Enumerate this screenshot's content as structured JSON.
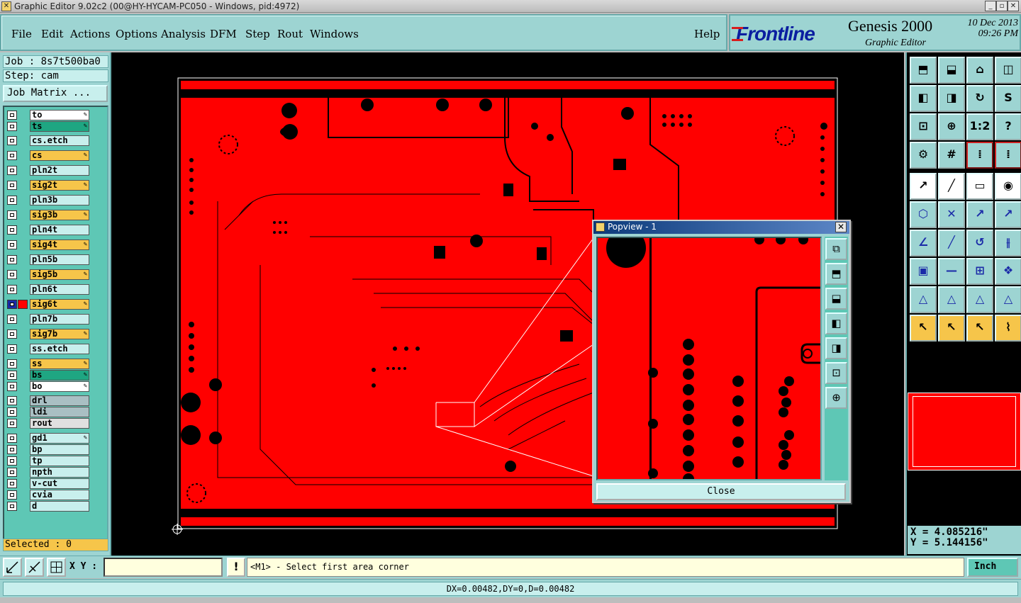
{
  "window": {
    "title": "Graphic Editor 9.02c2 (00@HY-HYCAM-PC050 - Windows, pid:4972)"
  },
  "menu": [
    "File",
    "Edit",
    "Actions",
    "Options",
    "Analysis",
    "DFM",
    "Step",
    "Rout",
    "Windows"
  ],
  "help": "Help",
  "brand": {
    "logo": "Frontline",
    "product": "Genesis 2000",
    "subtitle": "Graphic Editor",
    "date": "10 Dec 2013",
    "time": "09:26 PM"
  },
  "job": {
    "job_line": "Job : 8s7t500ba0",
    "step_line": "Step: cam",
    "matrix_button": "Job Matrix ..."
  },
  "layers": [
    {
      "name": "to",
      "color": "#ffffff",
      "pen": true
    },
    {
      "name": "ts",
      "color": "#1fa682",
      "pen": true
    },
    {
      "name": "cs.etch",
      "color": "#c8efed",
      "pen": false
    },
    {
      "name": "cs",
      "color": "#f6c54a",
      "pen": true
    },
    {
      "name": "pln2t",
      "color": "#c8efed",
      "pen": false
    },
    {
      "name": "sig2t",
      "color": "#f6c54a",
      "pen": true
    },
    {
      "name": "pln3b",
      "color": "#c8efed",
      "pen": false
    },
    {
      "name": "sig3b",
      "color": "#f6c54a",
      "pen": true
    },
    {
      "name": "pln4t",
      "color": "#c8efed",
      "pen": false
    },
    {
      "name": "sig4t",
      "color": "#f6c54a",
      "pen": true
    },
    {
      "name": "pln5b",
      "color": "#c8efed",
      "pen": false
    },
    {
      "name": "sig5b",
      "color": "#f6c54a",
      "pen": true
    },
    {
      "name": "pln6t",
      "color": "#c8efed",
      "pen": false
    },
    {
      "name": "sig6t",
      "color": "#f6c54a",
      "pen": true,
      "active": true
    },
    {
      "name": "pln7b",
      "color": "#c8efed",
      "pen": false
    },
    {
      "name": "sig7b",
      "color": "#f6c54a",
      "pen": true
    },
    {
      "name": "ss.etch",
      "color": "#c8efed",
      "pen": false
    },
    {
      "name": "ss",
      "color": "#f6c54a",
      "pen": true
    },
    {
      "name": "bs",
      "color": "#1fa682",
      "pen": true
    },
    {
      "name": "bo",
      "color": "#ffffff",
      "pen": true
    },
    {
      "name": "drl",
      "color": "#a9bfc3",
      "pen": false
    },
    {
      "name": "ldi",
      "color": "#a9bfc3",
      "pen": false
    },
    {
      "name": "rout",
      "color": "#e0e0e0",
      "pen": false
    },
    {
      "name": "gd1",
      "color": "#c8efed",
      "pen": true
    },
    {
      "name": "bp",
      "color": "#c8efed",
      "pen": false
    },
    {
      "name": "tp",
      "color": "#c8efed",
      "pen": false
    },
    {
      "name": "npth",
      "color": "#c8efed",
      "pen": false
    },
    {
      "name": "v-cut",
      "color": "#c8efed",
      "pen": false
    },
    {
      "name": "cvia",
      "color": "#c8efed",
      "pen": false
    },
    {
      "name": "d",
      "color": "#c8efed",
      "pen": false
    }
  ],
  "selected": "Selected : 0",
  "popup": {
    "title": "Popview - 1",
    "close_label": "Close"
  },
  "coords": {
    "x": "X =  4.085216\"",
    "y": "Y =  5.144156\""
  },
  "bottom": {
    "xy_label": "X Y :",
    "xy_value": "",
    "info_label": "!",
    "prompt": "<M1> - Select first area corner",
    "units": "Inch"
  },
  "status": "DX=0.00482,DY=0,D=0.00482",
  "toolbar_icons": [
    "parent-icon",
    "child-icon",
    "home-icon",
    "window-icon",
    "left-icon",
    "right-icon",
    "pan-icon",
    "zoom-s-icon",
    "fit-icon",
    "center-icon",
    "one-to-one-icon",
    "help-icon",
    "settings-icon",
    "grid-icon",
    "layer-top-icon",
    "layer-bot-icon",
    "pointer-icon",
    "line-icon",
    "ruler-icon",
    "snap-icon",
    "net-icon",
    "cross-icon",
    "arrow-icon",
    "drag-icon",
    "angle-icon",
    "slant-icon",
    "rotate-icon",
    "mirror-icon",
    "pad-icon",
    "minus-icon",
    "measure-icon",
    "group-icon",
    "tri1-icon",
    "tri2-icon",
    "tri3-icon",
    "tri4-icon",
    "select-icon",
    "select2-icon",
    "select3-icon",
    "net2-icon"
  ]
}
